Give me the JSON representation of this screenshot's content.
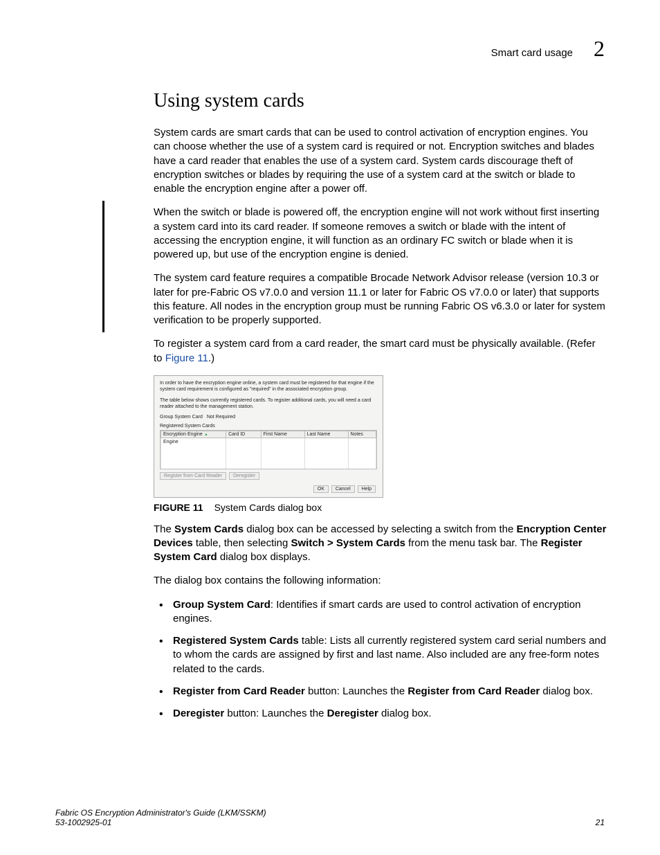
{
  "header": {
    "section": "Smart card usage",
    "chapter": "2"
  },
  "h1": "Using system cards",
  "p1": "System cards are smart cards that can be used to control activation of encryption engines. You can choose whether the use of a system card is required or not. Encryption switches and blades have a card reader that enables the use of a system card. System cards discourage theft of encryption switches or blades by requiring the use of a system card at the switch or blade to enable the encryption engine after a power off.",
  "p2": "When the switch or blade is powered off, the encryption engine will not work without first inserting a system card into its card reader. If someone removes a switch or blade with the intent of accessing the encryption engine, it will function as an ordinary FC switch or blade when it is powered up, but use of the encryption engine is denied.",
  "p3": "The system card feature requires a compatible Brocade Network Advisor release (version 10.3 or later for pre-Fabric OS v7.0.0 and version 11.1 or later for Fabric OS v7.0.0 or later) that supports this feature. All nodes in the encryption group must be running Fabric OS v6.3.0 or later for system verification to be properly supported.",
  "p4a": "To register a system card from a card reader, the smart card must be physically available. (Refer to ",
  "p4_link": "Figure 11",
  "p4b": ".)",
  "dialog": {
    "info1": "In order to have the encryption engine online, a system card must be registered for that engine if the system card requirement is configured as \"required\" in the associated encryption group.",
    "info2": "The table below shows currently registered cards. To register additional cards, you will need a card reader attached to the management station.",
    "gsc_label": "Group System Card",
    "gsc_value": "Not Required",
    "rsc_label": "Registered System Cards",
    "cols": {
      "c1": "Encryption Engine",
      "c2": "Card ID",
      "c3": "First Name",
      "c4": "Last Name",
      "c5": "Notes"
    },
    "row1c1": "Engine",
    "btn_register": "Register from Card Reader",
    "btn_deregister": "Deregister",
    "btn_ok": "OK",
    "btn_cancel": "Cancel",
    "btn_help": "Help"
  },
  "figcap_label": "FIGURE 11",
  "figcap_text": "System Cards dialog box",
  "p5a": "The ",
  "p5b": "System Cards",
  "p5c": " dialog box can be accessed by selecting a switch from the ",
  "p5d": "Encryption Center Devices",
  "p5e": " table, then selecting ",
  "p5f": "Switch > System Cards",
  "p5g": " from the menu task bar. The ",
  "p5h": "Register System Card",
  "p5i": " dialog box displays.",
  "p6": "The dialog box contains the following information:",
  "li1a": "Group System Card",
  "li1b": ": Identifies if smart cards are used to control activation of encryption engines.",
  "li2a": "Registered System Cards",
  "li2b": " table: Lists all currently registered system card serial numbers and to whom the cards are assigned by first and last name. Also included are any free-form notes related to the cards.",
  "li3a": "Register from Card Reader",
  "li3b": " button: Launches the ",
  "li3c": "Register from Card Reader",
  "li3d": " dialog box.",
  "li4a": "Deregister",
  "li4b": " button: Launches the ",
  "li4c": "Deregister",
  "li4d": " dialog box.",
  "footer": {
    "left1": "Fabric OS Encryption Administrator's Guide  (LKM/SSKM)",
    "left2": "53-1002925-01",
    "right": "21"
  }
}
